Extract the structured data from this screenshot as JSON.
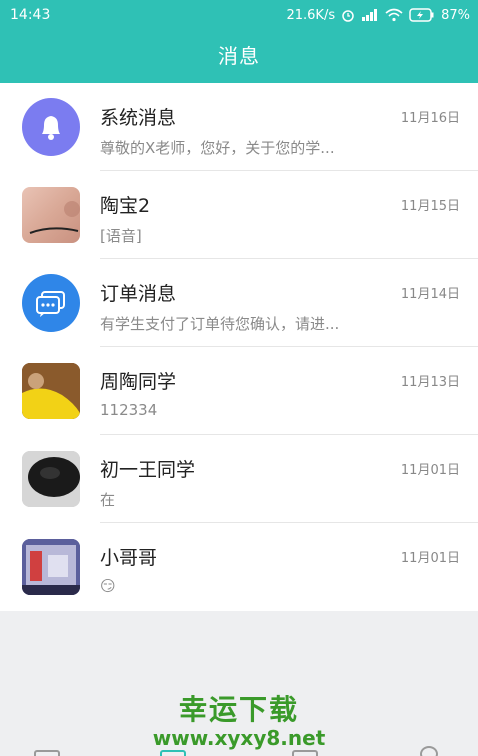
{
  "status_bar": {
    "time": "14:43",
    "speed": "21.6K/s",
    "battery": "87%"
  },
  "header": {
    "title": "消息"
  },
  "messages": [
    {
      "name": "系统消息",
      "date": "11月16日",
      "preview": "尊敬的X老师，您好，关于您的学...",
      "avatar": "bell-icon"
    },
    {
      "name": "陶宝2",
      "date": "11月15日",
      "preview": "[语音]",
      "avatar": "photo"
    },
    {
      "name": "订单消息",
      "date": "11月14日",
      "preview": "有学生支付了订单待您确认，请进...",
      "avatar": "chat-icon"
    },
    {
      "name": "周陶同学",
      "date": "11月13日",
      "preview": "112334",
      "avatar": "photo"
    },
    {
      "name": "初一王同学",
      "date": "11月01日",
      "preview": "在",
      "avatar": "photo"
    },
    {
      "name": "小哥哥",
      "date": "11月01日",
      "preview": "😏",
      "avatar": "photo"
    }
  ],
  "watermark": {
    "line1": "幸运下载",
    "line2": "www.xyxy8.net"
  },
  "colors": {
    "header": "#2fc1b5",
    "bell_avatar": "#7b7cf0",
    "chat_avatar": "#2f86e8"
  }
}
